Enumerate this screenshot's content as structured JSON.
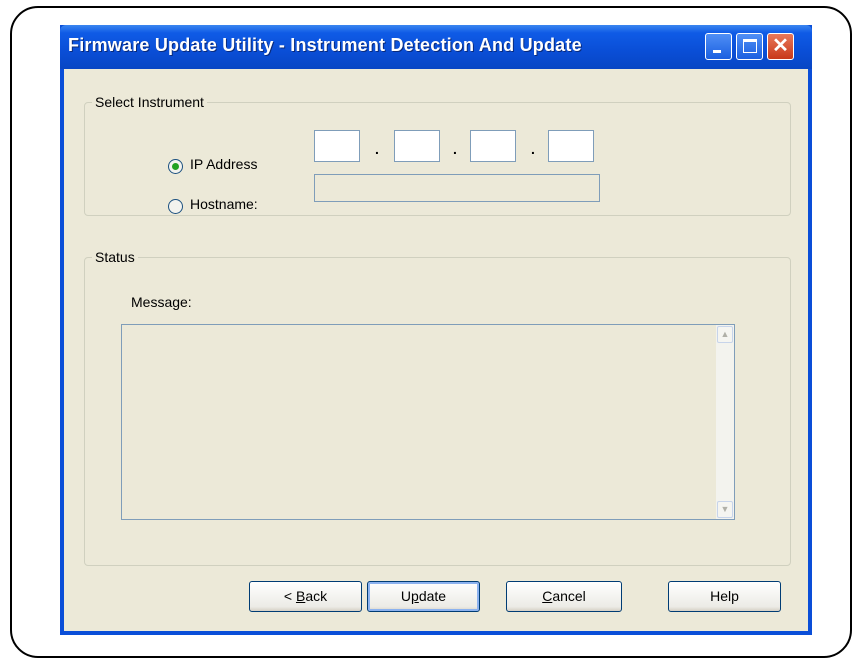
{
  "window": {
    "title": "Firmware Update Utility - Instrument Detection And Update"
  },
  "select_instrument": {
    "legend": "Select Instrument",
    "ip_radio_label": "IP Address",
    "hostname_radio_label": "Hostname:",
    "selected": "ip_address",
    "ip_octets": [
      "",
      "",
      "",
      ""
    ],
    "ip_separator": ".",
    "hostname_value": ""
  },
  "status": {
    "legend": "Status",
    "message_label": "Message:",
    "message_value": ""
  },
  "buttons": {
    "back": {
      "before": "< ",
      "accel": "B",
      "after": "ack"
    },
    "update": {
      "before": "U",
      "accel": "p",
      "after": "date"
    },
    "cancel": {
      "before": "",
      "accel": "C",
      "after": "ancel"
    },
    "help": "Help"
  },
  "icons": {
    "minimize": "minimize-icon",
    "maximize": "maximize-icon",
    "close": "close-icon",
    "scroll_up": "scroll-up-icon",
    "scroll_down": "scroll-down-icon"
  },
  "colors": {
    "titlebar": "#0a4ed8",
    "dialog_background": "#ece9d8",
    "radio_selected": "#21a121",
    "close_button": "#c8381a"
  }
}
